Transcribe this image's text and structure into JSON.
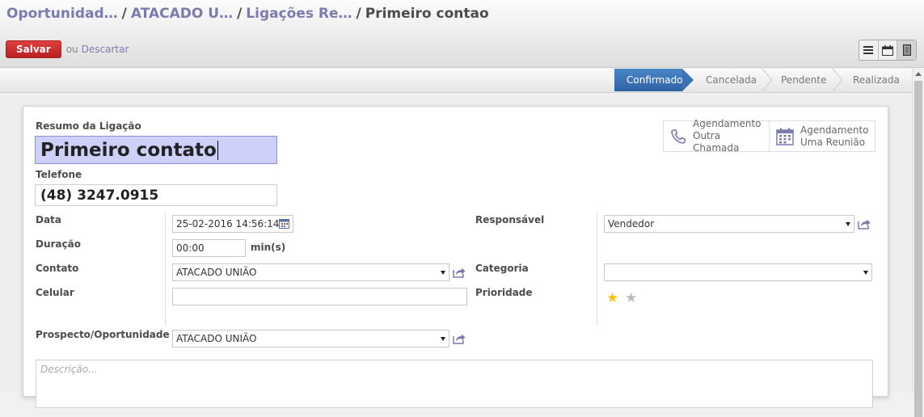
{
  "breadcrumb": {
    "items": [
      "Oportunidad…",
      "ATACADO U…",
      "Ligações Re…"
    ],
    "separator": "/",
    "current": "Primeiro contao"
  },
  "toolbar": {
    "save_label": "Salvar",
    "or_label": "ou",
    "discard_label": "Descartar"
  },
  "view_switcher": {
    "icons": [
      "list-view-icon",
      "calendar-view-icon",
      "form-view-icon"
    ],
    "active": "form-view-icon"
  },
  "statusbar": {
    "stages": [
      "Confirmado",
      "Cancelada",
      "Pendente",
      "Realizada"
    ],
    "active": "Confirmado"
  },
  "smart_buttons": [
    {
      "icon": "phone-icon",
      "line1": "Agendamento",
      "line2": "Outra Chamada"
    },
    {
      "icon": "calendar-icon",
      "line1": "Agendamento",
      "line2": "Uma Reunião"
    }
  ],
  "form": {
    "summary_label": "Resumo da Ligação",
    "summary_value": "Primeiro contato",
    "phone_label": "Telefone",
    "phone_value": "(48) 3247.0915",
    "date_label": "Data",
    "date_value": "25-02-2016 14:56:14",
    "duration_label": "Duração",
    "duration_value": "00:00",
    "duration_unit": "min(s)",
    "contact_label": "Contato",
    "contact_value": "ATACADO UNIÃO",
    "mobile_label": "Celular",
    "mobile_value": "",
    "prospect_label": "Prospecto/Oportunidade",
    "prospect_value": "ATACADO UNIÃO",
    "responsible_label": "Responsável",
    "responsible_value": "Vendedor",
    "category_label": "Categoria",
    "category_value": "",
    "priority_label": "Prioridade",
    "priority": {
      "value": 1,
      "max": 2
    },
    "description_placeholder": "Descrição..."
  },
  "colors": {
    "brand_link": "#7c7bad",
    "save_button": "#c62828",
    "active_stage": "#3a72b6",
    "title_highlight": "#cdd0f8",
    "star_on": "#f2c40f",
    "star_off": "#bbbbbb"
  }
}
